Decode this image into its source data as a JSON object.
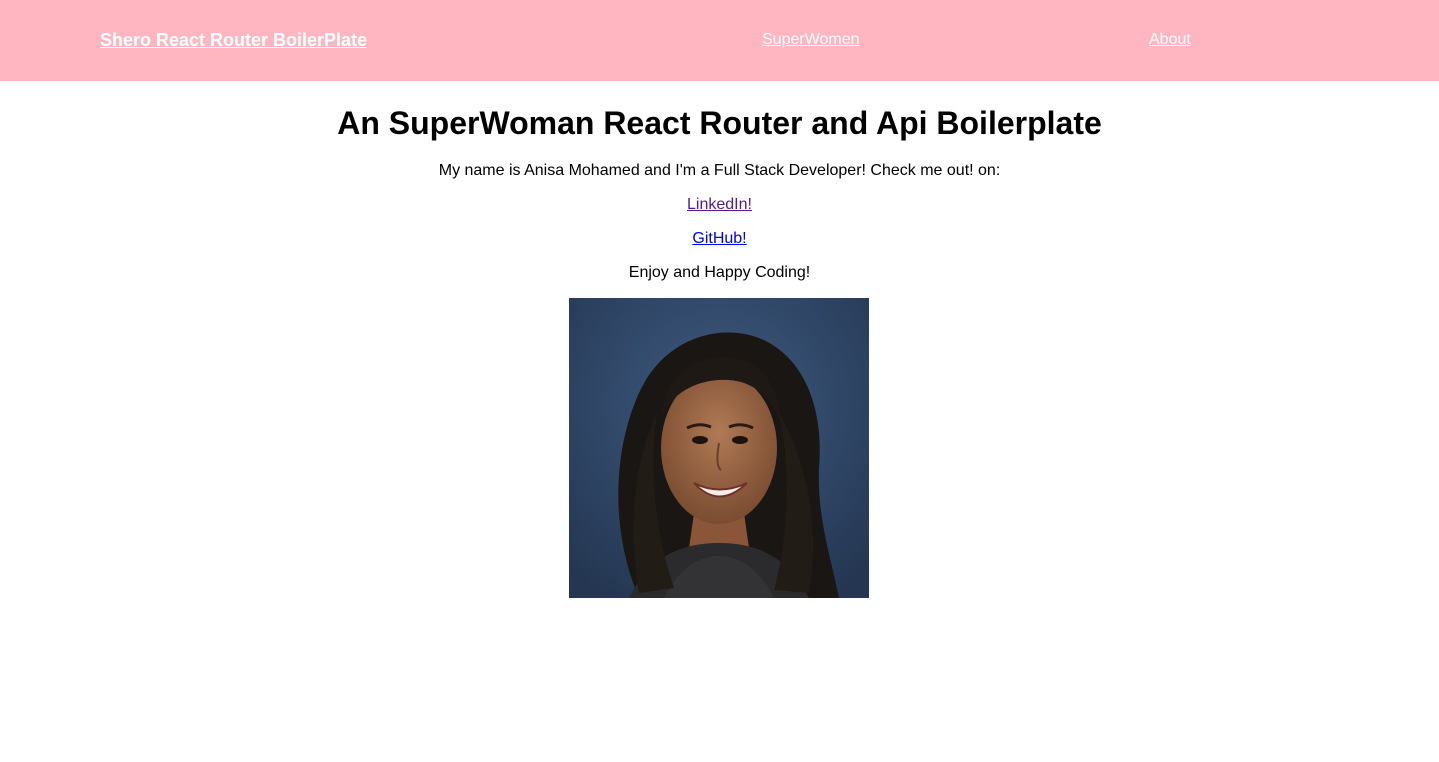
{
  "navbar": {
    "brand": "Shero React Router BoilerPlate",
    "links": [
      {
        "label": "SuperWomen"
      },
      {
        "label": "About"
      }
    ],
    "background_color": "#ffb6c1",
    "text_color": "#ffffff"
  },
  "main": {
    "title": "An SuperWoman React Router and Api Boilerplate",
    "intro": "My name is Anisa Mohamed and I'm a Full Stack Developer! Check me out! on:",
    "linkedin_label": "LinkedIn!",
    "github_label": "GitHub!",
    "outro": "Enjoy and Happy Coding!",
    "portrait_image": "portrait-photo"
  },
  "colors": {
    "visited_link": "#551a8b",
    "link": "#0000ee"
  }
}
